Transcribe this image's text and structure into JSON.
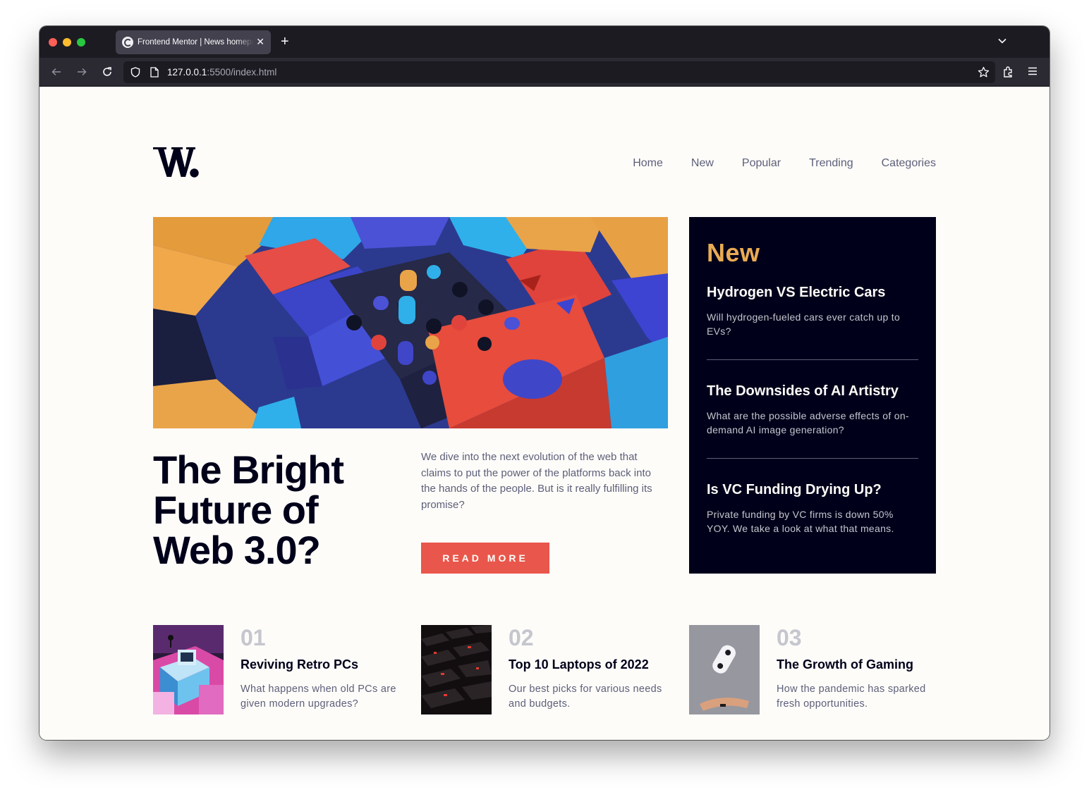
{
  "browser": {
    "tab_title": "Frontend Mentor | News homepage",
    "url_host": "127.0.0.1",
    "url_rest": ":5500/index.html",
    "icons": [
      "close-icon",
      "plus-icon",
      "chevron-down-icon",
      "back-arrow-icon",
      "forward-arrow-icon",
      "reload-icon",
      "shield-icon",
      "page-icon",
      "star-icon",
      "extensions-icon",
      "hamburger-menu-icon"
    ]
  },
  "site": {
    "nav": [
      "Home",
      "New",
      "Popular",
      "Trending",
      "Categories"
    ],
    "hero": {
      "title": "The Bright Future of Web 3.0?",
      "description": "We dive into the next evolution of the web that claims to put the power of the platforms back into the hands of the people. But is it really fulfilling its promise?",
      "button": "READ MORE"
    },
    "new_section": {
      "title": "New",
      "items": [
        {
          "title": "Hydrogen VS Electric Cars",
          "description": "Will hydrogen-fueled cars ever catch up to EVs?"
        },
        {
          "title": "The Downsides of AI Artistry",
          "description": "What are the possible adverse effects of on-demand AI image generation?"
        },
        {
          "title": "Is VC Funding Drying Up?",
          "description": "Private funding by VC firms is down 50% YOY. We take a look at what that means."
        }
      ]
    },
    "cards": [
      {
        "number": "01",
        "title": "Reviving Retro PCs",
        "description": "What happens when old PCs are given modern upgrades?"
      },
      {
        "number": "02",
        "title": "Top 10 Laptops of 2022",
        "description": "Our best picks for various needs and budgets."
      },
      {
        "number": "03",
        "title": "The Growth of Gaming",
        "description": "How the pandemic has sparked fresh opportunities."
      }
    ]
  },
  "colors": {
    "accent_orange": "#e9ab53",
    "accent_red": "#e9564b",
    "dark_navy": "#00001a",
    "grayish_blue": "#5d5f79",
    "off_white": "#fdfcf9"
  }
}
